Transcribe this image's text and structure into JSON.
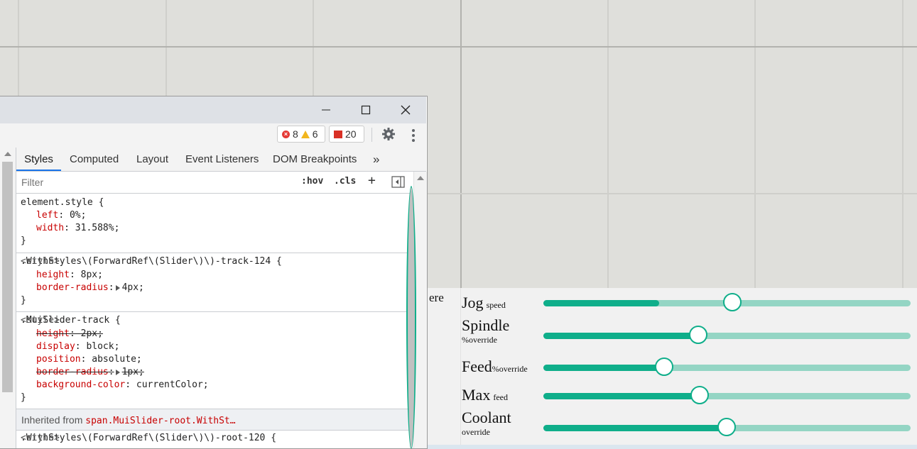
{
  "devtools": {
    "badges": {
      "errors": "8",
      "warnings": "6",
      "issues": "20"
    },
    "tabs": [
      "Styles",
      "Computed",
      "Layout",
      "Event Listeners",
      "DOM Breakpoints"
    ],
    "more_tabs": "»",
    "filter_placeholder": "Filter",
    "hov": ":hov",
    "cls": ".cls",
    "plus": "+",
    "rules": [
      {
        "selector": "element.style {",
        "source": "",
        "props": [
          {
            "name": "left",
            "value": "0%;"
          },
          {
            "name": "width",
            "value": "31.588%;"
          }
        ]
      },
      {
        "selector": ".WithStyles\\(ForwardRef\\(Slider\\)\\)-track-124 {",
        "source": "<style>",
        "props": [
          {
            "name": "height",
            "value": "8px;"
          },
          {
            "name": "border-radius",
            "value": "4px;"
          }
        ]
      },
      {
        "selector": ".MuiSlider-track {",
        "source": "<style>",
        "props": [
          {
            "name": "height",
            "value": "2px;"
          },
          {
            "name": "display",
            "value": "block;"
          },
          {
            "name": "position",
            "value": "absolute;"
          },
          {
            "name": "border-radius",
            "value": "1px;"
          },
          {
            "name": "background-color",
            "value": "currentColor;"
          }
        ]
      },
      {
        "selector": ".WithStyles\\(ForwardRef\\(Slider\\)\\)-root-120 {",
        "source": "<style>"
      }
    ],
    "close_brace": "}",
    "inherited_label": "Inherited from",
    "inherited_selector": "span.MuiSlider-root.WithSt…"
  },
  "panel": {
    "clipped_text": "ere",
    "sliders": [
      {
        "name": "Jog",
        "sub": "speed",
        "value": 0.515,
        "fill": 0.316
      },
      {
        "name": "Spindle",
        "sub": "%override",
        "value": 0.421,
        "fill": 0.421
      },
      {
        "name": "Feed",
        "sub": "%override",
        "value": 0.329,
        "fill": 0.329
      },
      {
        "name": "Max",
        "sub": "feed",
        "value": 0.426,
        "fill": 0.426
      },
      {
        "name": "Coolant",
        "sub": "override",
        "value": 0.499,
        "fill": 0.499
      }
    ]
  },
  "colors": {
    "accent": "#0fae8a",
    "rail": "#94d5c4",
    "canvas": "#dfdfdb"
  }
}
